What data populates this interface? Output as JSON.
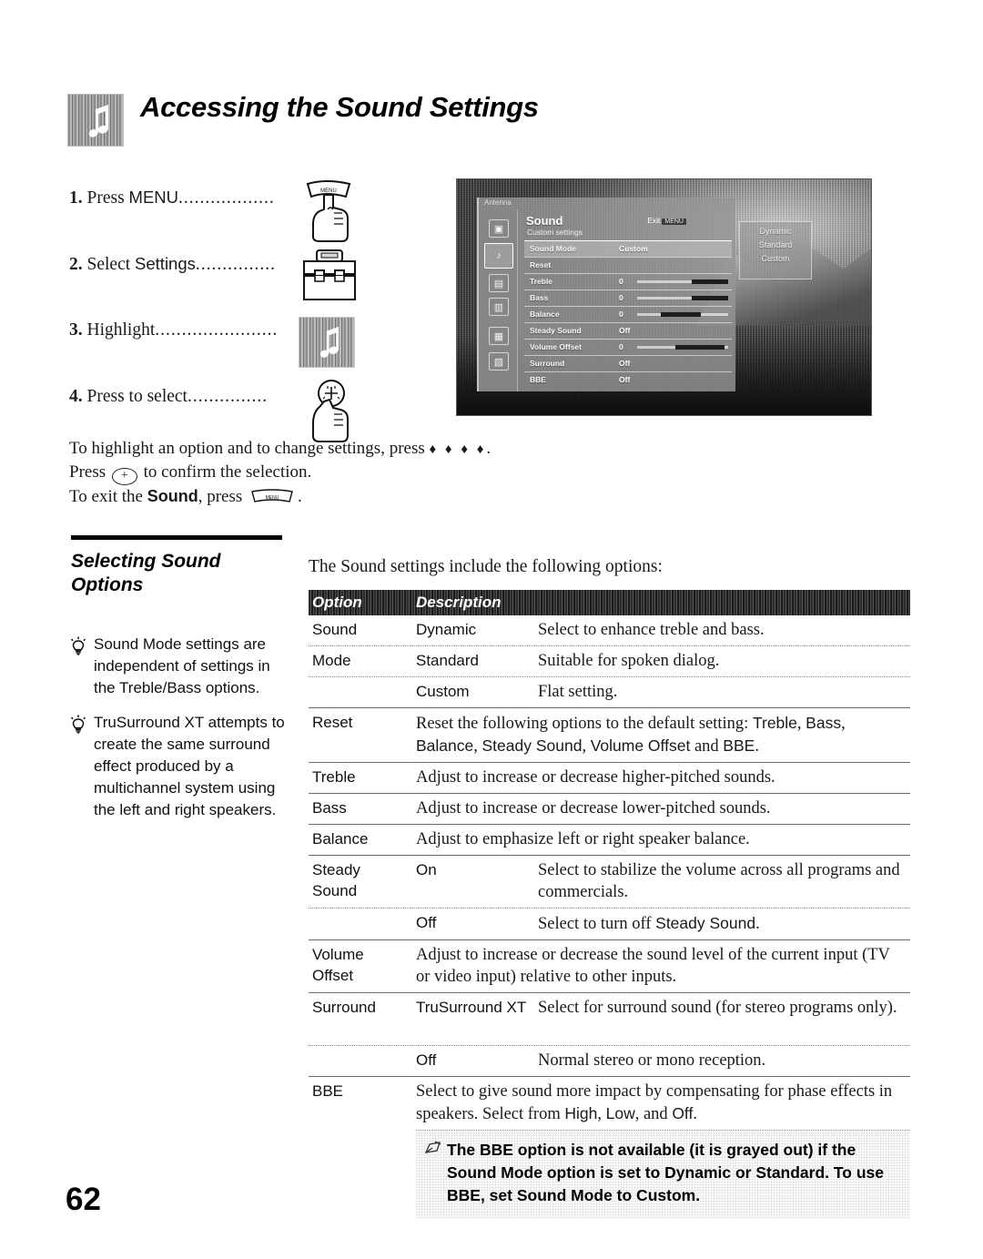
{
  "header": {
    "title": "Accessing the Sound Settings",
    "icon": "music-note-icon"
  },
  "steps": [
    {
      "num": "1.",
      "text": "Press ",
      "label": "MENU",
      "dots": "..................",
      "icon": "hand-pressing-menu-button-icon"
    },
    {
      "num": "2.",
      "text": "Select ",
      "label": "Settings",
      "dots": "...............",
      "icon": "toolbox-icon"
    },
    {
      "num": "3.",
      "text": "Highlight",
      "label": "",
      "dots": ".......................",
      "icon": "music-note-tile-icon"
    },
    {
      "num": "4.",
      "text": "Press to select",
      "label": "",
      "dots": "...............",
      "icon": "hand-pressing-select-button-icon"
    }
  ],
  "howto": {
    "line1_a": "To highlight an option and to change settings, press ",
    "line1_arrows": "♦ ♦ ♦ ♦",
    "line1_b": ".",
    "line2_a": "Press ",
    "line2_key": "+",
    "line2_b": " to confirm the selection.",
    "line3_a": "To exit the ",
    "line3_sound": "Sound",
    "line3_b": ", press ",
    "line3_key": "MENU",
    "line3_c": "."
  },
  "tv_screenshot": {
    "antenna_label": "Antenna",
    "menu_title": "Sound",
    "menu_subtitle": "Custom settings",
    "exit_label": "Exit",
    "exit_key": "MENU",
    "rail_icons": [
      "picture-icon",
      "sound-icon",
      "screen-icon",
      "channel-icon",
      "parental-lock-icon",
      "setup-icon"
    ],
    "rows": [
      {
        "label": "Sound Mode",
        "value": "Custom",
        "bar": false,
        "highlight": true
      },
      {
        "label": "Reset",
        "value": "",
        "bar": false,
        "highlight": false
      },
      {
        "label": "Treble",
        "value": "0",
        "bar": true,
        "highlight": false
      },
      {
        "label": "Bass",
        "value": "0",
        "bar": true,
        "highlight": false
      },
      {
        "label": "Balance",
        "value": "0",
        "bar": true,
        "highlight": false
      },
      {
        "label": "Steady Sound",
        "value": "Off",
        "bar": false,
        "highlight": false
      },
      {
        "label": "Volume Offset",
        "value": "0",
        "bar": true,
        "highlight": false
      },
      {
        "label": "Surround",
        "value": "Off",
        "bar": false,
        "highlight": false
      },
      {
        "label": "BBE",
        "value": "Off",
        "bar": false,
        "highlight": false
      }
    ],
    "popup_options": [
      "Dynamic",
      "Standard",
      "Custom"
    ]
  },
  "section": {
    "title_line1": "Selecting Sound",
    "title_line2": "Options"
  },
  "tips": [
    {
      "icon": "lightbulb-icon",
      "text": "Sound Mode settings are independent of settings in the Treble/Bass options."
    },
    {
      "icon": "lightbulb-icon",
      "text": "TruSurround XT attempts to create the same surround effect produced by a multichannel system using the left and right speakers."
    }
  ],
  "table": {
    "intro": "The Sound settings include the following options:",
    "headers": {
      "option": "Option",
      "description": "Description"
    },
    "rows": [
      {
        "option": "Sound",
        "option2": "Mode",
        "sub": "Dynamic",
        "desc": "Select to enhance treble and bass."
      },
      {
        "option": "",
        "option2": "",
        "sub": "Standard",
        "desc": "Suitable for spoken dialog."
      },
      {
        "option": "",
        "option2": "",
        "sub": "Custom",
        "desc": "Flat setting."
      },
      {
        "option": "Reset",
        "option2": "",
        "sub": "",
        "desc": "Reset the following options to the default setting: Treble, Bass, Balance, Steady Sound, Volume Offset and BBE."
      },
      {
        "option": "Treble",
        "option2": "",
        "sub": "",
        "desc": "Adjust to increase or decrease higher-pitched sounds."
      },
      {
        "option": "Bass",
        "option2": "",
        "sub": "",
        "desc": "Adjust to increase or decrease lower-pitched sounds."
      },
      {
        "option": "Balance",
        "option2": "",
        "sub": "",
        "desc": "Adjust to emphasize left or right speaker balance."
      },
      {
        "option": "Steady",
        "option2": "Sound",
        "sub": "On",
        "desc": "Select to stabilize the volume across all programs and commercials."
      },
      {
        "option": "",
        "option2": "",
        "sub": "Off",
        "desc": "Select to turn off Steady Sound."
      },
      {
        "option": "Volume",
        "option2": "Offset",
        "sub": "",
        "desc": "Adjust to increase or decrease the sound level of the current input (TV or video input) relative to other inputs."
      },
      {
        "option": "Surround",
        "option2": "",
        "sub": "TruSurround XT",
        "desc": "Select for surround sound (for stereo programs only)."
      },
      {
        "option": "",
        "option2": "",
        "sub": "Off",
        "desc": "Normal stereo or mono reception."
      },
      {
        "option": "BBE",
        "option2": "",
        "sub": "",
        "desc": "Select to give sound more impact by compensating for phase effects in speakers. Select from High, Low, and Off."
      }
    ],
    "note": {
      "icon": "note-pencil-icon",
      "text": "The BBE option is not available (it is grayed out) if the Sound Mode option is set to Dynamic or Standard. To use BBE, set Sound Mode to Custom."
    }
  },
  "page_number": "62"
}
